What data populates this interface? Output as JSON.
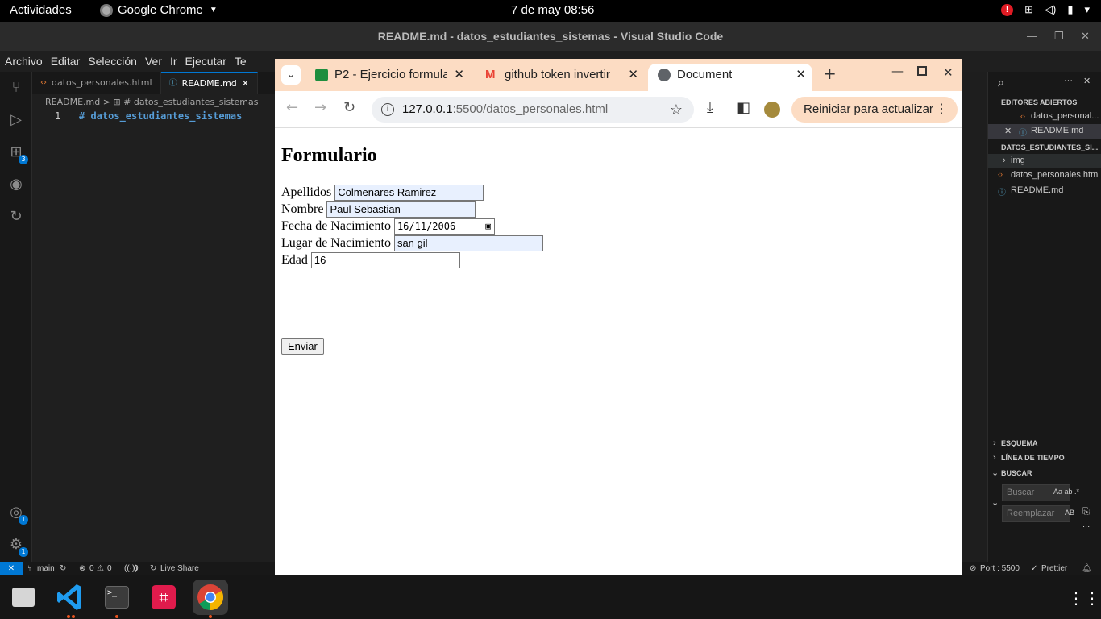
{
  "topbar": {
    "activities": "Actividades",
    "app_name": "Google Chrome",
    "clock": "7 de may  08:56",
    "alert": "!"
  },
  "vscode": {
    "title": "README.md - datos_estudiantes_sistemas - Visual Studio Code",
    "menu": [
      "Archivo",
      "Editar",
      "Selección",
      "Ver",
      "Ir",
      "Ejecutar",
      "Te"
    ],
    "tabs": [
      {
        "label": "datos_personales.html",
        "icon": "html-icon"
      },
      {
        "label": "README.md",
        "icon": "info-icon"
      }
    ],
    "breadcrumb": "README.md  > ⊞ # datos_estudiantes_sistemas",
    "editor": {
      "line_number": "1",
      "code": "# datos_estudiantes_sistemas"
    },
    "badges": {
      "extensions": "3",
      "accounts": "1",
      "settings": "1"
    },
    "explorer": {
      "open_editors_header": "EDITORES ABIERTOS",
      "open_editors": [
        "datos_personal...",
        "README.md"
      ],
      "folder_header": "DATOS_ESTUDIANTES_SI...",
      "folder_items": [
        "img",
        "datos_personales.html",
        "README.md"
      ],
      "outline": "ESQUEMA",
      "timeline": "LÍNEA DE TIEMPO",
      "search_header": "BUSCAR",
      "search_placeholder": "Buscar",
      "search_opts": "Aa ab .*",
      "replace_placeholder": "Reemplazar",
      "replace_opts": "AB",
      "more": "..."
    },
    "status": {
      "branch": "main",
      "errors": "0",
      "warnings": "0",
      "ports": "0",
      "live_share": "Live Share",
      "port": "Port : 5500",
      "prettier": "Prettier"
    }
  },
  "chrome": {
    "tabs": [
      {
        "title": "P2 - Ejercicio formula",
        "favicon_color": "#1e8e3e"
      },
      {
        "title": "github token invertir",
        "favicon_color": "#ea4335"
      },
      {
        "title": "Document",
        "favicon_color": "#5f6368"
      }
    ],
    "new_tab": "+",
    "url_host": "127.0.0.1",
    "url_path": ":5500/datos_personales.html",
    "relaunch": "Reiniciar para actualizar"
  },
  "form": {
    "heading": "Formulario",
    "fields": [
      {
        "label": "Apellidos",
        "value": "Colmenares Ramirez"
      },
      {
        "label": "Nombre",
        "value": "Paul Sebastian"
      },
      {
        "label": "Fecha de Nacimiento",
        "value": "16/11/2006"
      },
      {
        "label": "Lugar de Nacimiento",
        "value": "san gil"
      },
      {
        "label": "Edad",
        "value": "16"
      }
    ],
    "submit": "Enviar"
  }
}
